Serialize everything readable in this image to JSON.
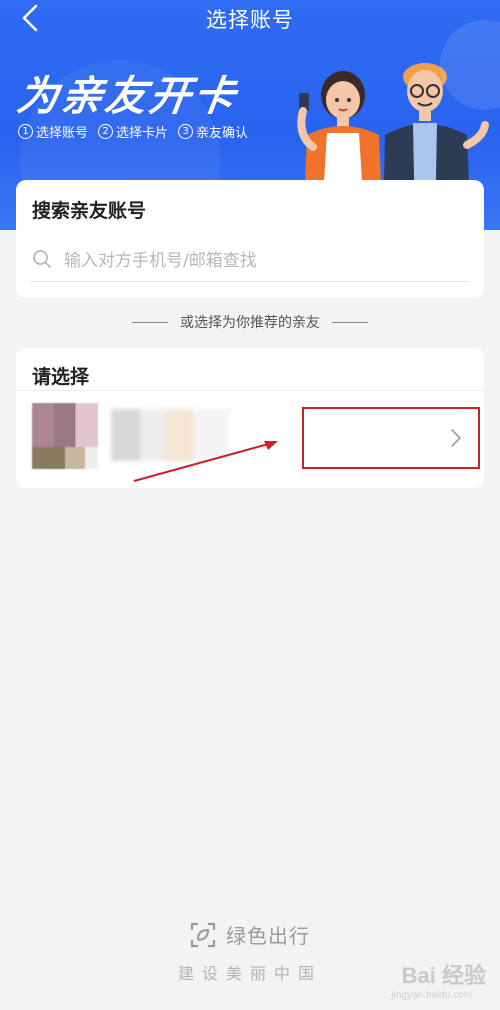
{
  "nav": {
    "title": "选择账号"
  },
  "hero": {
    "title": "为亲友开卡",
    "steps": [
      {
        "num": "1",
        "label": "选择账号"
      },
      {
        "num": "2",
        "label": "选择卡片"
      },
      {
        "num": "3",
        "label": "亲友确认"
      }
    ]
  },
  "search": {
    "title": "搜索亲友账号",
    "placeholder": "输入对方手机号/邮箱查找"
  },
  "divider": {
    "text": "或选择为你推荐的亲友"
  },
  "select": {
    "title": "请选择"
  },
  "footer": {
    "brand": "绿色出行",
    "slogan": "建设美丽中国"
  },
  "watermark": {
    "text": "Bai 经验",
    "sub": "jingyan.baidu.com"
  },
  "colors": {
    "header_blue": "#2f6cf2",
    "highlight_red": "#d11f2a"
  },
  "icons": {
    "back": "chevron-left-icon",
    "search": "search-icon",
    "row_arrow": "chevron-right-icon",
    "footer_logo": "scan-leaf-icon"
  }
}
